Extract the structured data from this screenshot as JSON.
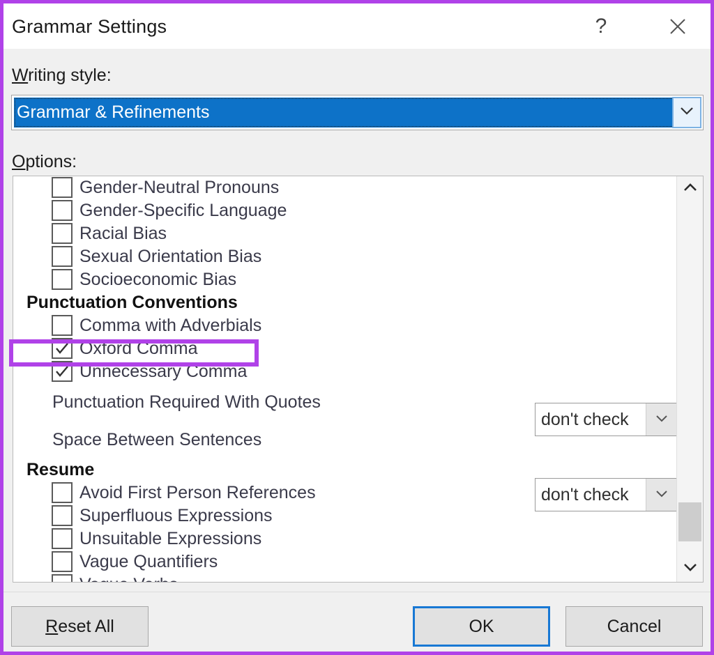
{
  "window": {
    "title": "Grammar Settings",
    "help_icon": "question-mark-icon",
    "close_icon": "close-icon"
  },
  "writing_style": {
    "label": "Writing style:",
    "accel": "W",
    "label_rest": "riting style:",
    "selected": "Grammar & Refinements",
    "arrow_icon": "chevron-down-icon"
  },
  "options": {
    "label": "Options:",
    "accel": "O",
    "label_rest": "ptions:",
    "rows": [
      {
        "kind": "check",
        "label": "Gender-Neutral Pronouns",
        "checked": false
      },
      {
        "kind": "check",
        "label": "Gender-Specific Language",
        "checked": false
      },
      {
        "kind": "check",
        "label": "Racial Bias",
        "checked": false
      },
      {
        "kind": "check",
        "label": "Sexual Orientation Bias",
        "checked": false
      },
      {
        "kind": "check",
        "label": "Socioeconomic Bias",
        "checked": false
      },
      {
        "kind": "group",
        "label": "Punctuation Conventions"
      },
      {
        "kind": "check",
        "label": "Comma with Adverbials",
        "checked": false
      },
      {
        "kind": "check",
        "label": "Oxford Comma",
        "checked": true
      },
      {
        "kind": "check",
        "label": "Unnecessary Comma",
        "checked": true
      },
      {
        "kind": "select",
        "label": "Punctuation Required With Quotes",
        "value": "don't check"
      },
      {
        "kind": "select",
        "label": "Space Between Sentences",
        "value": "don't check"
      },
      {
        "kind": "group",
        "label": "Resume"
      },
      {
        "kind": "check",
        "label": "Avoid First Person References",
        "checked": false
      },
      {
        "kind": "check",
        "label": "Superfluous Expressions",
        "checked": false
      },
      {
        "kind": "check",
        "label": "Unsuitable Expressions",
        "checked": false
      },
      {
        "kind": "check",
        "label": "Vague Quantifiers",
        "checked": false
      },
      {
        "kind": "check",
        "label": "Vague Verbs",
        "checked": false
      }
    ]
  },
  "scrollbar": {
    "up_icon": "chevron-up-icon",
    "down_icon": "chevron-down-icon"
  },
  "highlight": {
    "color": "#b042e8",
    "target": "Punctuation Conventions"
  },
  "footer": {
    "reset_accel": "R",
    "reset_rest": "eset All",
    "reset_label": "Reset All",
    "ok_label": "OK",
    "cancel_label": "Cancel"
  }
}
